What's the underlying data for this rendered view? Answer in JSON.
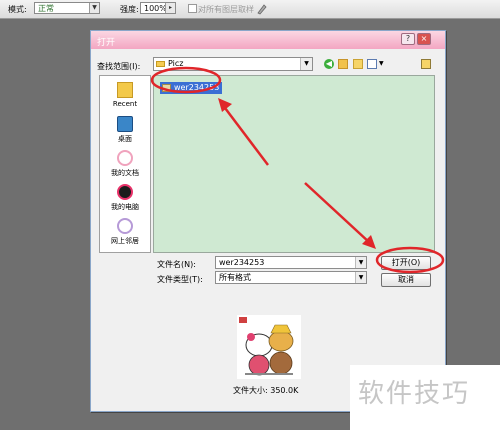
{
  "optionsbar": {
    "mode_label": "模式:",
    "mode_value": "正常",
    "strength_label": "强度:",
    "strength_value": "100%",
    "sample_all_layers": "对所有图层取样"
  },
  "dialog": {
    "title": "打开",
    "help_symbol": "?",
    "close_symbol": "×",
    "look_in_label": "查找范围(I):",
    "look_in_value": "Picz",
    "places": [
      {
        "label": "Recent",
        "icon": "recent-folder-icon"
      },
      {
        "label": "桌面",
        "icon": "desktop-icon"
      },
      {
        "label": "我的文档",
        "icon": "hello-kitty-pink-icon"
      },
      {
        "label": "我的电脑",
        "icon": "hello-kitty-black-icon"
      },
      {
        "label": "网上邻居",
        "icon": "hello-kitty-lavender-icon"
      }
    ],
    "files": [
      {
        "name": "wer234253"
      }
    ],
    "file_name_label": "文件名(N):",
    "file_name_value": "wer234253",
    "file_type_label": "文件类型(T):",
    "file_type_value": "所有格式",
    "open_button": "打开(O)",
    "cancel_button": "取消",
    "preview_size": "文件大小: 350.0K"
  },
  "watermark": "软件技巧",
  "colors": {
    "titlebar": "#f3a6c2",
    "filelist_bg": "#cfe9d2",
    "annotation": "#e0262a"
  }
}
